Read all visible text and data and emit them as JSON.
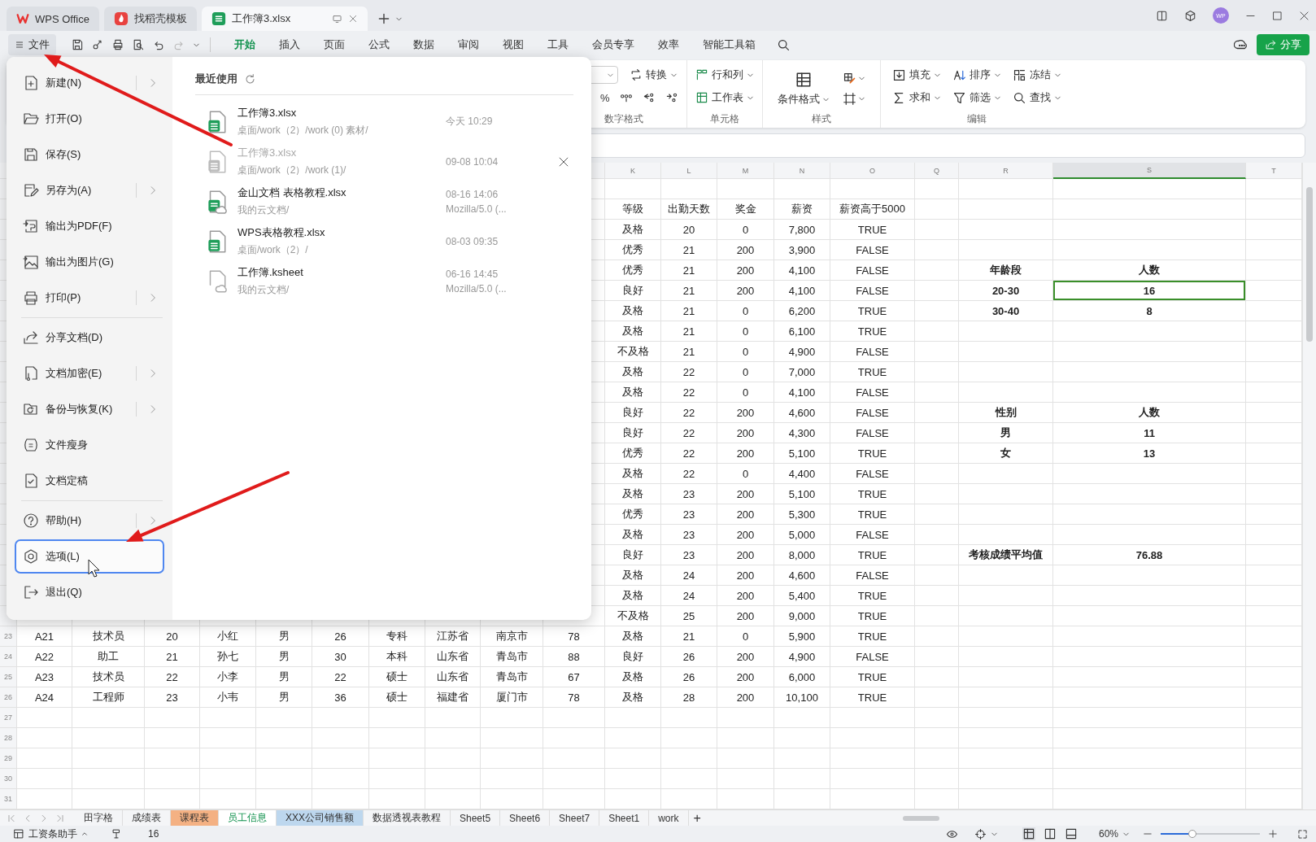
{
  "title_bar": {
    "tabs": [
      {
        "label": "WPS Office",
        "kind": "home",
        "selected": false
      },
      {
        "label": "找稻壳模板",
        "kind": "template",
        "selected": false
      },
      {
        "label": "工作簿3.xlsx",
        "kind": "sheet",
        "selected": true
      }
    ],
    "avatar": "WP"
  },
  "menu_bar": {
    "file_button": "文件",
    "tabs": [
      {
        "label": "开始",
        "selected": true
      },
      {
        "label": "插入",
        "selected": false
      },
      {
        "label": "页面",
        "selected": false
      },
      {
        "label": "公式",
        "selected": false
      },
      {
        "label": "数据",
        "selected": false
      },
      {
        "label": "审阅",
        "selected": false
      },
      {
        "label": "视图",
        "selected": false
      },
      {
        "label": "工具",
        "selected": false
      },
      {
        "label": "会员专享",
        "selected": false
      },
      {
        "label": "效率",
        "selected": false
      },
      {
        "label": "智能工具箱",
        "selected": false
      }
    ],
    "share_button": "分享"
  },
  "ribbon": {
    "number_format": {
      "convert": "转换",
      "percent": "%",
      "label": "数字格式"
    },
    "cells": {
      "rows_cols": "行和列",
      "worksheet": "工作表",
      "label": "单元格"
    },
    "styles": {
      "conditional_format": "条件格式",
      "label": "样式"
    },
    "editing": {
      "buttons": [
        {
          "label": "填充",
          "kind": "fill"
        },
        {
          "label": "排序",
          "kind": "sort"
        },
        {
          "label": "冻结",
          "kind": "freeze"
        },
        {
          "label": "求和",
          "kind": "sum"
        },
        {
          "label": "筛选",
          "kind": "filter"
        },
        {
          "label": "查找",
          "kind": "find"
        }
      ],
      "label": "编辑"
    }
  },
  "sheet": {
    "column_headers": [
      {
        "label": "K",
        "selected": false
      },
      {
        "label": "L",
        "selected": false
      },
      {
        "label": "M",
        "selected": false
      },
      {
        "label": "N",
        "selected": false
      },
      {
        "label": "O",
        "selected": false
      },
      {
        "label": "Q",
        "selected": false
      },
      {
        "label": "R",
        "selected": false
      },
      {
        "label": "S",
        "selected": true
      },
      {
        "label": "T",
        "selected": false
      }
    ],
    "rows": [
      {
        "stats": [
          "等级",
          "出勤天数",
          "奖金",
          "薪资",
          "薪资高于5000"
        ]
      },
      {
        "stats": [
          "及格",
          "20",
          "0",
          "7,800",
          "TRUE"
        ]
      },
      {
        "stats": [
          "优秀",
          "21",
          "200",
          "3,900",
          "FALSE"
        ]
      },
      {
        "stats": [
          "优秀",
          "21",
          "200",
          "4,100",
          "FALSE"
        ],
        "summary": [
          {
            "text": "年龄段",
            "selected": false
          },
          {
            "text": "人数",
            "selected": false
          }
        ]
      },
      {
        "stats": [
          "良好",
          "21",
          "200",
          "4,100",
          "FALSE"
        ],
        "summary": [
          {
            "text": "20-30",
            "selected": false
          },
          {
            "text": "16",
            "selected": true
          }
        ]
      },
      {
        "stats": [
          "及格",
          "21",
          "0",
          "6,200",
          "TRUE"
        ],
        "summary": [
          {
            "text": "30-40",
            "selected": false
          },
          {
            "text": "8",
            "selected": false
          }
        ]
      },
      {
        "stats": [
          "及格",
          "21",
          "0",
          "6,100",
          "TRUE"
        ]
      },
      {
        "stats": [
          "不及格",
          "21",
          "0",
          "4,900",
          "FALSE"
        ]
      },
      {
        "stats": [
          "及格",
          "22",
          "0",
          "7,000",
          "TRUE"
        ]
      },
      {
        "stats": [
          "及格",
          "22",
          "0",
          "4,100",
          "FALSE"
        ]
      },
      {
        "stats": [
          "良好",
          "22",
          "200",
          "4,600",
          "FALSE"
        ],
        "summary": [
          {
            "text": "性别",
            "selected": false
          },
          {
            "text": "人数",
            "selected": false
          }
        ]
      },
      {
        "stats": [
          "良好",
          "22",
          "200",
          "4,300",
          "FALSE"
        ],
        "summary": [
          {
            "text": "男",
            "selected": false
          },
          {
            "text": "11",
            "selected": false
          }
        ]
      },
      {
        "stats": [
          "优秀",
          "22",
          "200",
          "5,100",
          "TRUE"
        ],
        "summary": [
          {
            "text": "女",
            "selected": false
          },
          {
            "text": "13",
            "selected": false
          }
        ]
      },
      {
        "stats": [
          "及格",
          "22",
          "0",
          "4,400",
          "FALSE"
        ]
      },
      {
        "stats": [
          "及格",
          "23",
          "200",
          "5,100",
          "TRUE"
        ]
      },
      {
        "stats": [
          "优秀",
          "23",
          "200",
          "5,300",
          "TRUE"
        ]
      },
      {
        "stats": [
          "及格",
          "23",
          "200",
          "5,000",
          "FALSE"
        ]
      },
      {
        "stats": [
          "良好",
          "23",
          "200",
          "8,000",
          "TRUE"
        ],
        "summary": [
          {
            "text": "考核成绩平均值",
            "selected": false
          },
          {
            "text": "76.88",
            "selected": false
          }
        ]
      },
      {
        "stats": [
          "及格",
          "24",
          "200",
          "4,600",
          "FALSE"
        ]
      },
      {
        "stats": [
          "及格",
          "24",
          "200",
          "5,400",
          "TRUE"
        ]
      },
      {
        "stats": [
          "不及格",
          "25",
          "200",
          "9,000",
          "TRUE"
        ]
      },
      {
        "number": "23",
        "data": [
          "A21",
          "技术员",
          "20",
          "小红",
          "男",
          "26",
          "专科",
          "江苏省",
          "南京市",
          "78"
        ],
        "stats": [
          "及格",
          "21",
          "0",
          "5,900",
          "TRUE"
        ]
      },
      {
        "number": "24",
        "data": [
          "A22",
          "助工",
          "21",
          "孙七",
          "男",
          "30",
          "本科",
          "山东省",
          "青岛市",
          "88"
        ],
        "stats": [
          "良好",
          "26",
          "200",
          "4,900",
          "FALSE"
        ]
      },
      {
        "number": "25",
        "data": [
          "A23",
          "技术员",
          "22",
          "小李",
          "男",
          "22",
          "硕士",
          "山东省",
          "青岛市",
          "67"
        ],
        "stats": [
          "及格",
          "26",
          "200",
          "6,000",
          "TRUE"
        ]
      },
      {
        "number": "26",
        "data": [
          "A24",
          "工程师",
          "23",
          "小韦",
          "男",
          "36",
          "硕士",
          "福建省",
          "厦门市",
          "78"
        ],
        "stats": [
          "及格",
          "28",
          "200",
          "10,100",
          "TRUE"
        ]
      },
      {
        "number": "27"
      },
      {
        "number": "28"
      },
      {
        "number": "29"
      },
      {
        "number": "30"
      },
      {
        "number": "31"
      }
    ]
  },
  "file_menu": {
    "sections": [
      [
        {
          "label": "新建(N)",
          "kind": "new",
          "submenu": true,
          "selected": false
        },
        {
          "label": "打开(O)",
          "kind": "open",
          "submenu": false,
          "selected": false
        },
        {
          "label": "保存(S)",
          "kind": "save",
          "submenu": false,
          "selected": false
        },
        {
          "label": "另存为(A)",
          "kind": "save_as",
          "submenu": true,
          "selected": false
        },
        {
          "label": "输出为PDF(F)",
          "kind": "pdf",
          "submenu": false,
          "selected": false
        },
        {
          "label": "输出为图片(G)",
          "kind": "image",
          "submenu": false,
          "selected": false
        },
        {
          "label": "打印(P)",
          "kind": "print",
          "submenu": true,
          "selected": false
        }
      ],
      [
        {
          "label": "分享文档(D)",
          "kind": "share",
          "submenu": false,
          "selected": false
        },
        {
          "label": "文档加密(E)",
          "kind": "encrypt",
          "submenu": true,
          "selected": false
        },
        {
          "label": "备份与恢复(K)",
          "kind": "backup",
          "submenu": true,
          "selected": false
        },
        {
          "label": "文件瘦身",
          "kind": "slim",
          "submenu": false,
          "selected": false
        },
        {
          "label": "文档定稿",
          "kind": "finalize",
          "submenu": false,
          "selected": false
        }
      ],
      [
        {
          "label": "帮助(H)",
          "kind": "help",
          "submenu": true,
          "selected": false
        },
        {
          "label": "选项(L)",
          "kind": "options",
          "submenu": false,
          "selected": true
        },
        {
          "label": "退出(Q)",
          "kind": "exit",
          "submenu": false,
          "selected": false
        }
      ]
    ],
    "recent": {
      "title": "最近使用",
      "files": [
        {
          "name": "工作簿3.xlsx",
          "path": "桌面/work（2）/work (0) 素材/",
          "time": "今天  10:29",
          "kind": "sheet",
          "unavailable": false
        },
        {
          "name": "工作簿3.xlsx",
          "path": "桌面/work（2）/work (1)/",
          "time": "09-08 10:04",
          "kind": "sheet",
          "unavailable": true
        },
        {
          "name": "金山文档 表格教程.xlsx",
          "path": "我的云文档/",
          "time": "08-16 14:06",
          "source": "Mozilla/5.0 (...",
          "kind": "cloud_sheet",
          "unavailable": false
        },
        {
          "name": "WPS表格教程.xlsx",
          "path": "桌面/work（2）/",
          "time": "08-03 09:35",
          "kind": "sheet",
          "unavailable": false
        },
        {
          "name": "工作簿.ksheet",
          "path": "我的云文档/",
          "time": "06-16 14:45",
          "source": "Mozilla/5.0 (...",
          "kind": "cloud_blank",
          "unavailable": false
        }
      ]
    }
  },
  "sheet_tabs": {
    "tabs": [
      {
        "label": "田字格",
        "selected": false
      },
      {
        "label": "成绩表",
        "selected": false
      },
      {
        "label": "课程表",
        "selected": false,
        "color": "#f4b183"
      },
      {
        "label": "员工信息",
        "selected": true
      },
      {
        "label": "XXX公司销售额",
        "selected": false,
        "color": "#bdd7ee"
      },
      {
        "label": "数据透视表教程",
        "selected": false
      },
      {
        "label": "Sheet5",
        "selected": false
      },
      {
        "label": "Sheet6",
        "selected": false
      },
      {
        "label": "Sheet7",
        "selected": false
      },
      {
        "label": "Sheet1",
        "selected": false
      },
      {
        "label": "work",
        "selected": false
      }
    ],
    "add_sheet": "+"
  },
  "status_bar": {
    "helper": "工资条助手",
    "count": "16",
    "zoom": "60%",
    "zoom_slider": {
      "level": 0.32
    }
  }
}
